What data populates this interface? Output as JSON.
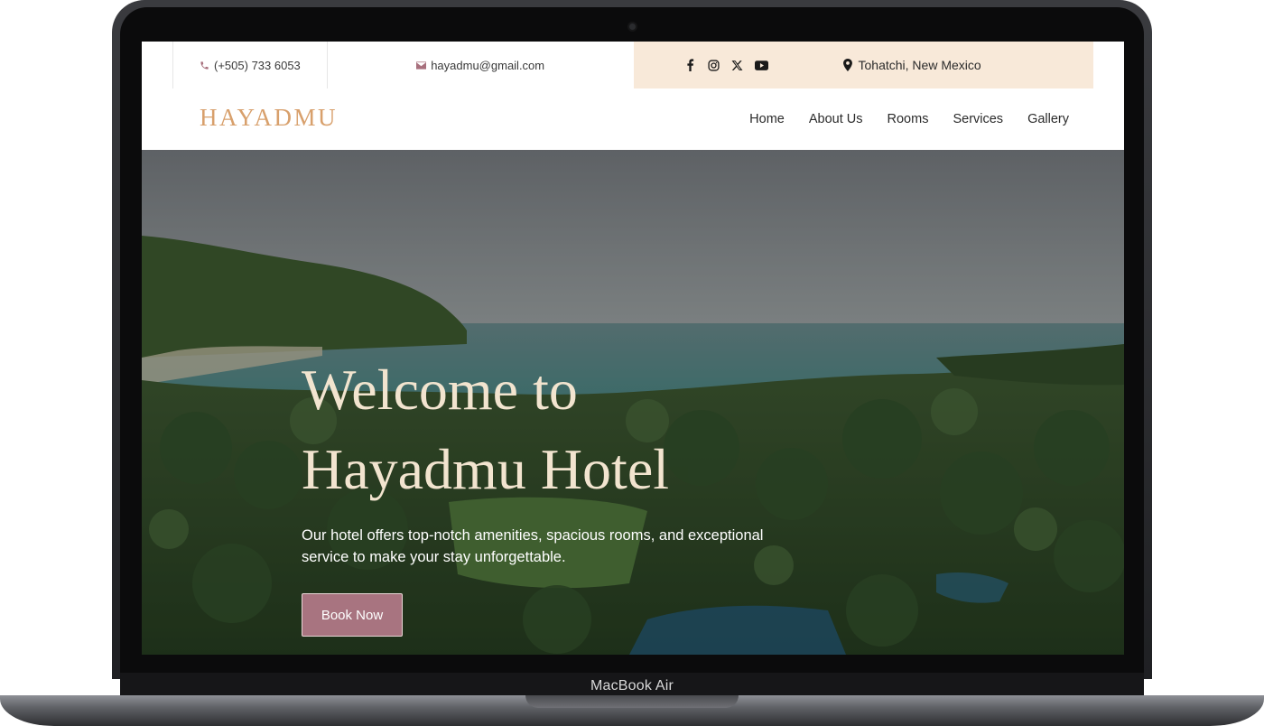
{
  "device": {
    "label": "MacBook Air"
  },
  "topbar": {
    "phone": "(+505) 733 6053",
    "email": "hayadmu@gmail.com",
    "social_icons": [
      "facebook-icon",
      "instagram-icon",
      "x-icon",
      "youtube-icon"
    ],
    "location": "Tohatchi, New Mexico"
  },
  "nav": {
    "logo": "HAYADMU",
    "links": [
      "Home",
      "About Us",
      "Rooms",
      "Services",
      "Gallery"
    ]
  },
  "hero": {
    "title_line1": "Welcome to",
    "title_line2": "Hayadmu Hotel",
    "description": "Our hotel offers top-notch amenities, spacious rooms, and exceptional service to make your stay unforgettable.",
    "cta": "Book Now"
  },
  "colors": {
    "accent": "#a87480",
    "logo": "#d8a06c",
    "info_bar_bg": "#f8e9d9",
    "hero_title": "#f2e4cf"
  }
}
